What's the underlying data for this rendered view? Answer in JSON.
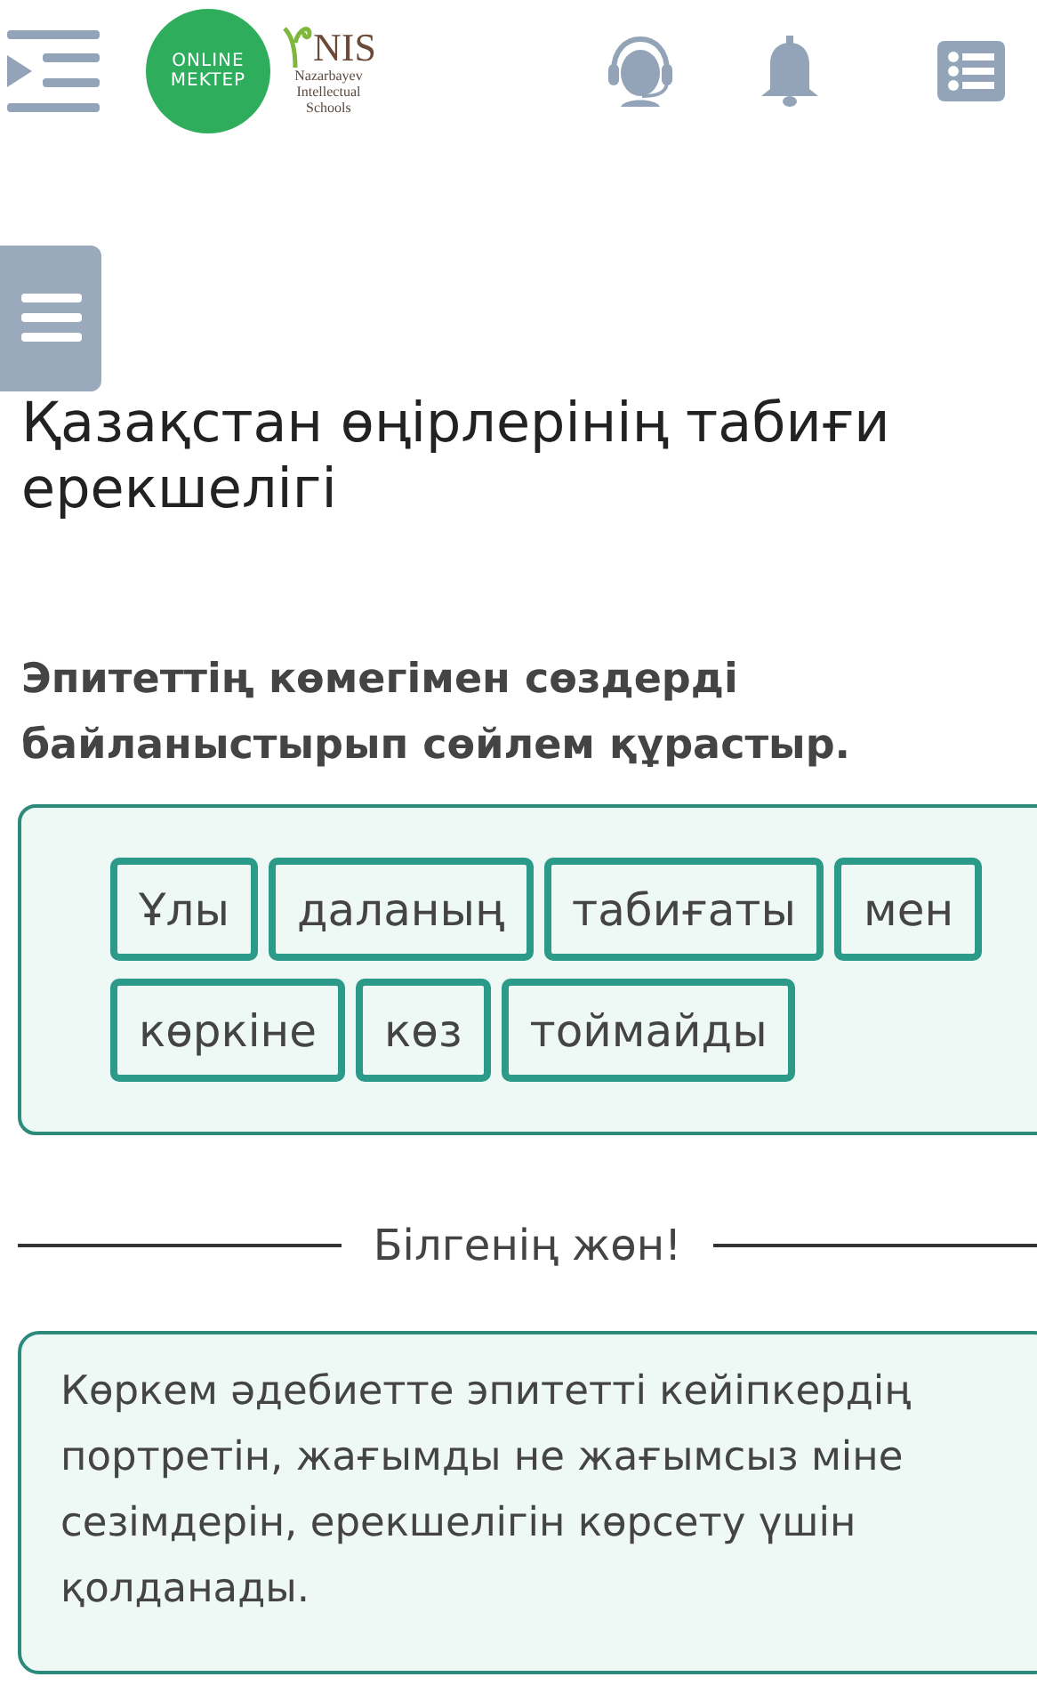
{
  "header": {
    "logo_lines": [
      "ONLINE",
      "MEKTEP"
    ],
    "brand": "NIS",
    "brand_subtitle": [
      "Nazarbayev",
      "Intellectual",
      "Schools"
    ]
  },
  "lesson_title": "Қазақстан өңірлерінің табиғи ерекшелігі",
  "task": {
    "instruction": "Эпитеттің көмегімен сөздерді байланыстырып сөйлем құрастыр.",
    "words": [
      {
        "text": "Ұлы"
      },
      {
        "text": "даланың"
      },
      {
        "text": "табиғаты"
      },
      {
        "text": "мен"
      },
      {
        "text": "көркіне"
      },
      {
        "text": "көз"
      },
      {
        "text": "тоймайды"
      }
    ]
  },
  "tip": {
    "heading": "Білгенің жөн!",
    "lines": [
      "Көркем әдебиетте эпитетті кейіпкердің",
      "портретін, жағымды не жағымсыз міне",
      "сезімдерін, ерекшелігін көрсету үшін",
      "қолданады."
    ]
  }
}
